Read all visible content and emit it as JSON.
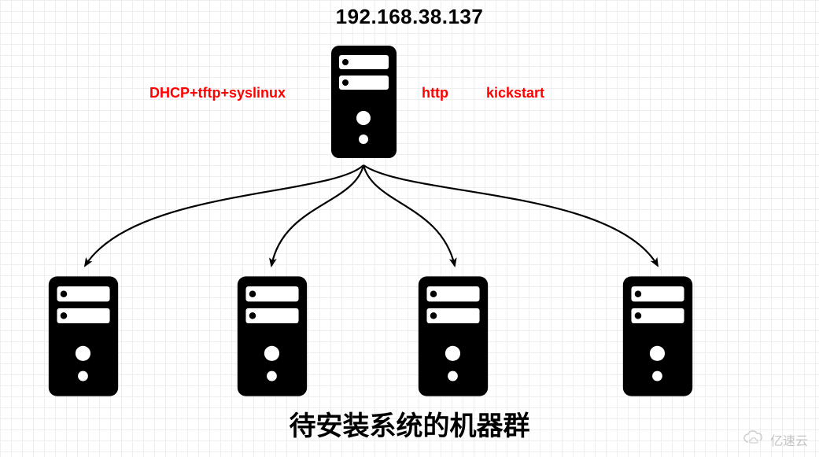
{
  "ip_address": "192.168.38.137",
  "labels": {
    "left_services": "DHCP+tftp+syslinux",
    "right_service_1": "http",
    "right_service_2": "kickstart"
  },
  "bottom_caption": "待安装系统的机器群",
  "watermark_text": "亿速云",
  "nodes": {
    "master": "server-icon",
    "clients": [
      "server-icon",
      "server-icon",
      "server-icon",
      "server-icon"
    ]
  }
}
